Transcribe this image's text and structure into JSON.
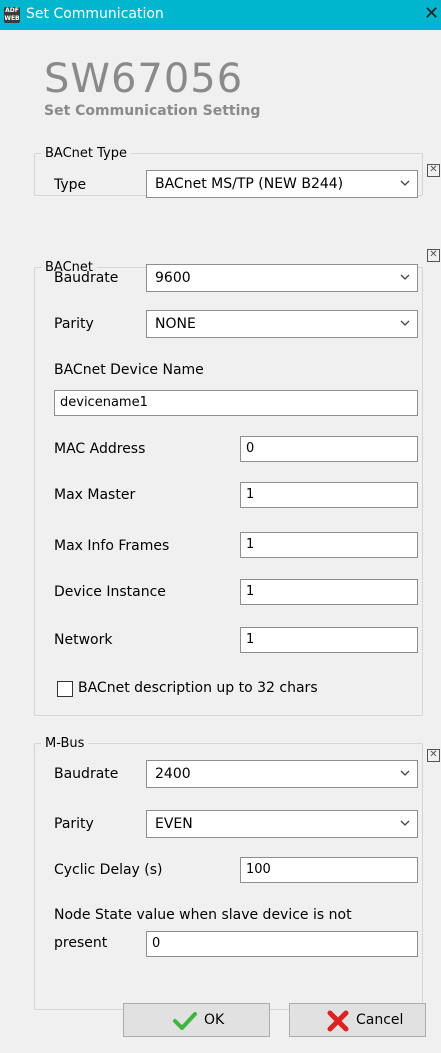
{
  "window": {
    "title": "Set Communication",
    "app_icon_text": "ADF WEB"
  },
  "header": {
    "product": "SW67056",
    "subtitle": "Set Communication Setting"
  },
  "bacnet_type": {
    "legend": "BACnet Type",
    "type_label": "Type",
    "type_value": "BACnet MS/TP (NEW B244)"
  },
  "bacnet": {
    "legend": "BACnet",
    "baudrate_label": "Baudrate",
    "baudrate_value": "9600",
    "parity_label": "Parity",
    "parity_value": "NONE",
    "device_name_label": "BACnet Device Name",
    "device_name_value": "devicename1",
    "mac_label": "MAC Address",
    "mac_value": "0",
    "max_master_label": "Max Master",
    "max_master_value": "1",
    "max_info_label": "Max Info Frames",
    "max_info_value": "1",
    "device_instance_label": "Device Instance",
    "device_instance_value": "1",
    "network_label": "Network",
    "network_value": "1",
    "desc_checkbox_label": "BACnet description up to 32 chars"
  },
  "mbus": {
    "legend": "M-Bus",
    "baudrate_label": "Baudrate",
    "baudrate_value": "2400",
    "parity_label": "Parity",
    "parity_value": "EVEN",
    "cyclic_label": "Cyclic Delay (s)",
    "cyclic_value": "100",
    "node_state_label_1": "Node State value when slave device is not",
    "node_state_label_2": "present",
    "node_state_value": "0"
  },
  "buttons": {
    "ok": "OK",
    "cancel": "Cancel"
  },
  "colors": {
    "titlebar": "#00b6ce",
    "ok_check": "#3fb53f",
    "cancel_x": "#e02020"
  }
}
